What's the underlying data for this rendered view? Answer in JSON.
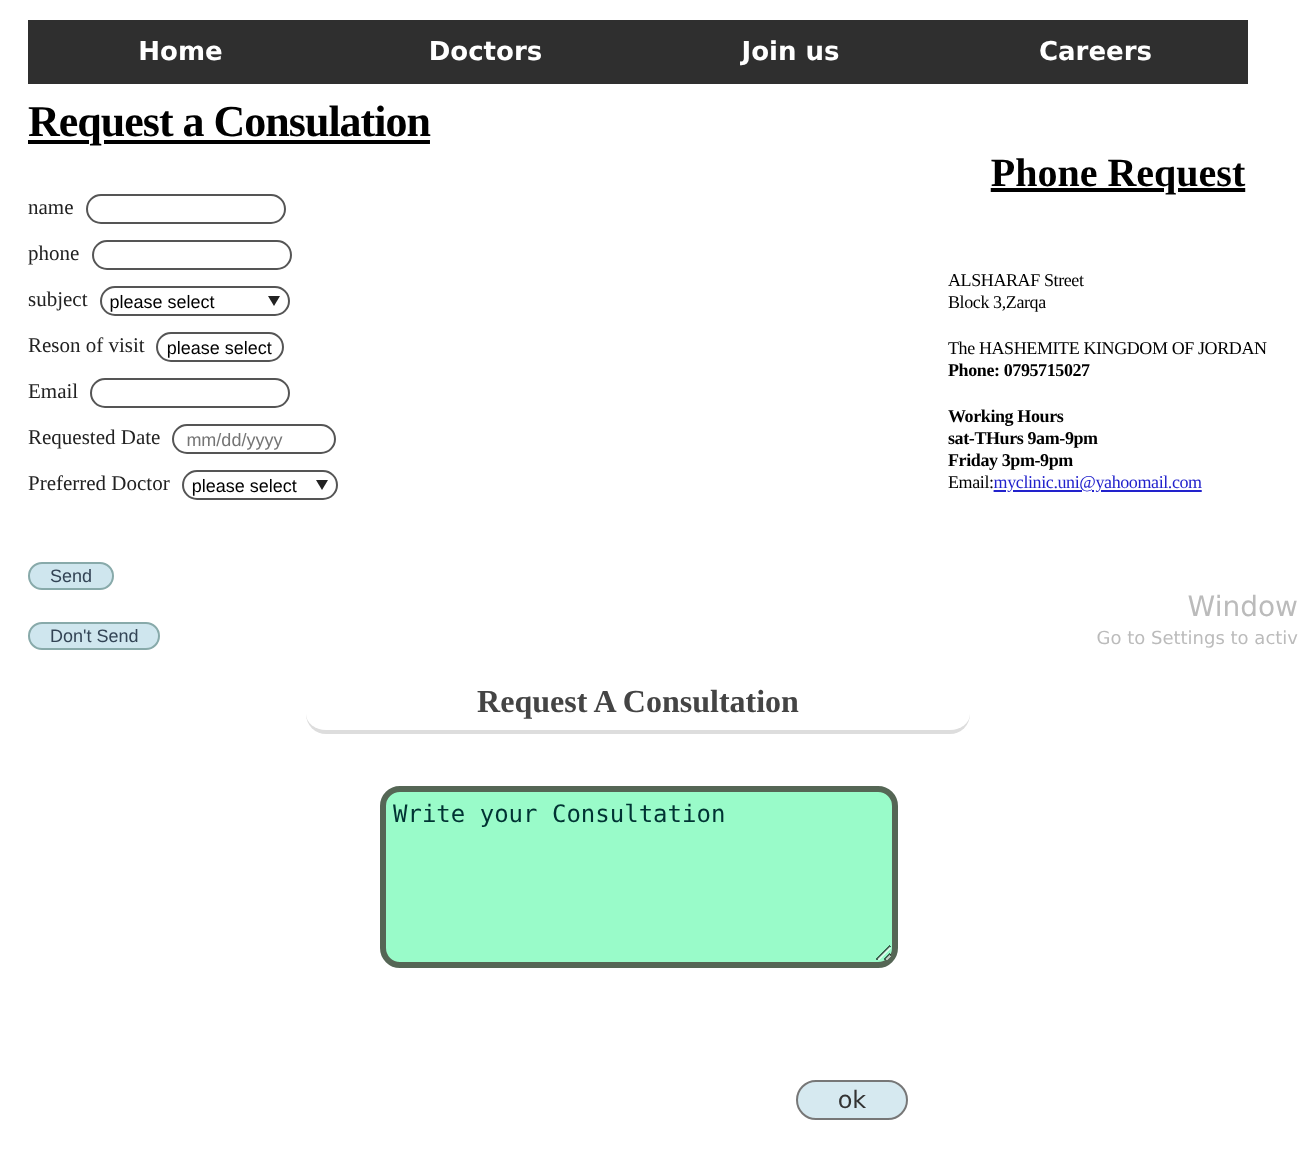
{
  "nav": [
    {
      "label": "Home"
    },
    {
      "label": "Doctors"
    },
    {
      "label": "Join us"
    },
    {
      "label": "Careers"
    }
  ],
  "title": "Request a Consulation",
  "form": {
    "fields": [
      {
        "label": "name",
        "kind": "text"
      },
      {
        "label": "phone",
        "kind": "text"
      },
      {
        "label": "subject",
        "kind": "select",
        "value": "please select"
      },
      {
        "label": "Reson of visit",
        "kind": "select",
        "value": "please select"
      },
      {
        "label": "Email",
        "kind": "text"
      },
      {
        "label": "Requested Date",
        "kind": "date",
        "placeholder": "mm/dd/yyyy"
      },
      {
        "label": "Preferred Doctor",
        "kind": "select",
        "value": "please select"
      }
    ],
    "buttons": [
      "Send",
      "Don't Send"
    ]
  },
  "phone_request": {
    "title": "Phone Request",
    "blocks": [
      [
        {
          "text": "ALSHARAF Street",
          "kind": "plain"
        },
        {
          "text": "Block 3,Zarqa",
          "kind": "plain"
        }
      ],
      [
        {
          "text": "The HASHEMITE KINGDOM OF JORDAN",
          "kind": "plain"
        },
        {
          "text": "Phone: 0795715027",
          "kind": "bold"
        }
      ],
      [
        {
          "text": "Working Hours",
          "kind": "bold"
        },
        {
          "text": "sat-THurs 9am-9pm",
          "kind": "bold"
        },
        {
          "text": "Friday 3pm-9pm",
          "kind": "bold"
        },
        {
          "text": "Email:",
          "kind": "email",
          "link": "myclinic.uni@yahoomail.com"
        }
      ]
    ]
  },
  "consultation": {
    "heading": "Request A Consultation",
    "textarea": {
      "placeholder": "Write your Consultation"
    },
    "button": "ok"
  },
  "os_overlay": {
    "title": "Window",
    "hint": "Go to Settings to activ"
  }
}
